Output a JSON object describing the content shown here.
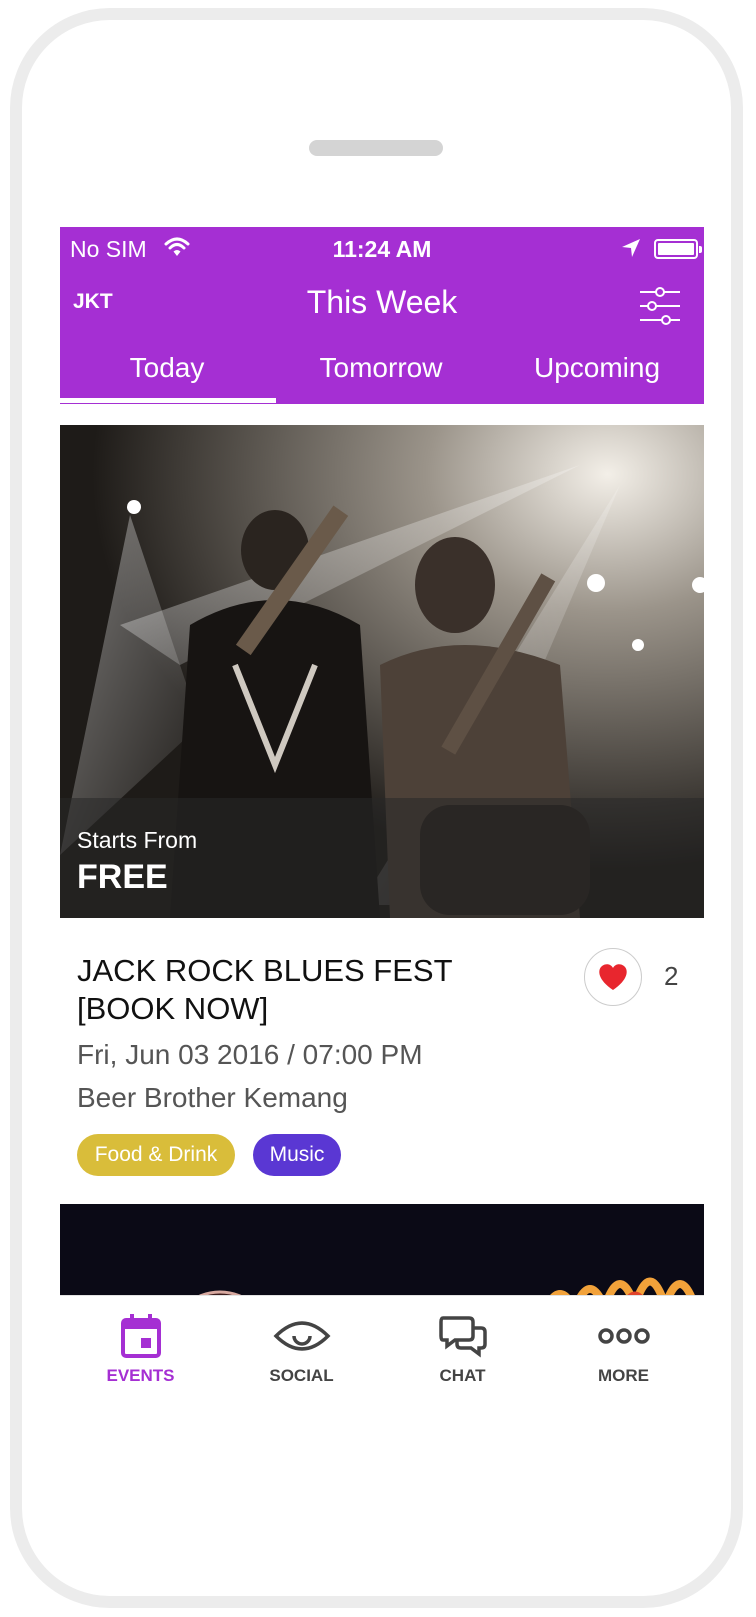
{
  "status_bar": {
    "carrier": "No SIM",
    "time": "11:24 AM"
  },
  "header": {
    "city": "JKT",
    "title": "This Week"
  },
  "tabs": [
    {
      "label": "Today",
      "active": true
    },
    {
      "label": "Tomorrow",
      "active": false
    },
    {
      "label": "Upcoming",
      "active": false
    }
  ],
  "event": {
    "price_label": "Starts From",
    "price_value": "FREE",
    "title": "JACK ROCK BLUES FEST [BOOK NOW]",
    "date": "Fri, Jun 03 2016 / 07:00 PM",
    "venue": "Beer Brother Kemang",
    "likes": "2",
    "tags": [
      {
        "label": "Food & Drink",
        "color": "#d9bd3a"
      },
      {
        "label": "Music",
        "color": "#5a37d3"
      }
    ]
  },
  "bottom_nav": [
    {
      "label": "EVENTS",
      "icon": "calendar-icon",
      "active": true
    },
    {
      "label": "SOCIAL",
      "icon": "eye-icon",
      "active": false
    },
    {
      "label": "CHAT",
      "icon": "chat-bubbles-icon",
      "active": false
    },
    {
      "label": "MORE",
      "icon": "more-dots-icon",
      "active": false
    }
  ],
  "colors": {
    "brand": "#a52fd3",
    "heart": "#e8262e"
  }
}
